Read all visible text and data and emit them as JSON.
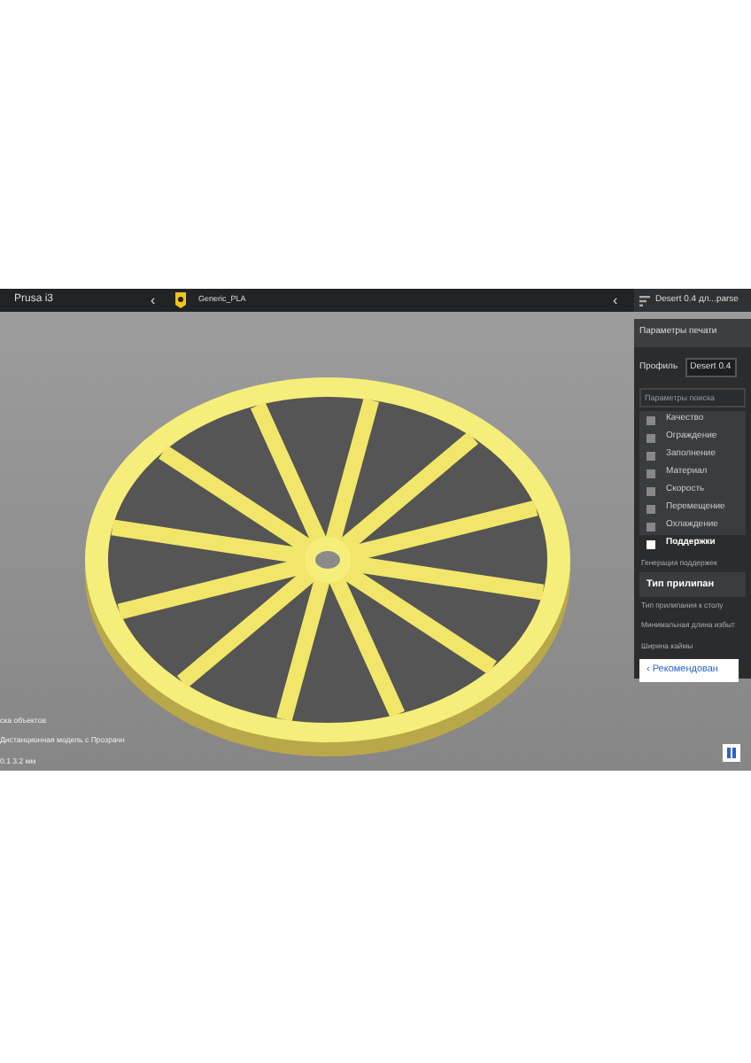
{
  "top_bar": {
    "printer": "Prusa i3",
    "back_arrow": "‹",
    "material": "Generic_PLA",
    "panel_arrow": "‹",
    "profile": "Desert 0.4 дл...parse"
  },
  "print_settings": {
    "title": "Параметры печати",
    "profile_label": "Профиль",
    "profile_value": "Desert 0.4",
    "search": {
      "placeholder": "Параметры поиска"
    },
    "categories": [
      {
        "label": "Качество",
        "selected": false
      },
      {
        "label": "Ограждение",
        "selected": false
      },
      {
        "label": "Заполнение",
        "selected": false
      },
      {
        "label": "Материал",
        "selected": false
      },
      {
        "label": "Скорость",
        "selected": false
      },
      {
        "label": "Перемещение",
        "selected": false
      },
      {
        "label": "Охлаждение",
        "selected": false
      },
      {
        "label": "Поддержки",
        "selected": true
      }
    ],
    "settings": [
      {
        "kind": "setting",
        "label": "Генерация поддержек"
      },
      {
        "kind": "header",
        "label": "Тип прилипан"
      },
      {
        "kind": "setting",
        "label": "Тип прилипания к столу"
      },
      {
        "kind": "setting",
        "label": "Минимальная длина избыт"
      },
      {
        "kind": "setting",
        "label": "Ширина каймы"
      }
    ],
    "recommended_button": {
      "arrow": "‹",
      "label": "Рекомендован"
    }
  },
  "status_lines": [
    "ска объектов",
    "Дистанционная модель с Прозрачн",
    "0.1 3.2 мм"
  ]
}
